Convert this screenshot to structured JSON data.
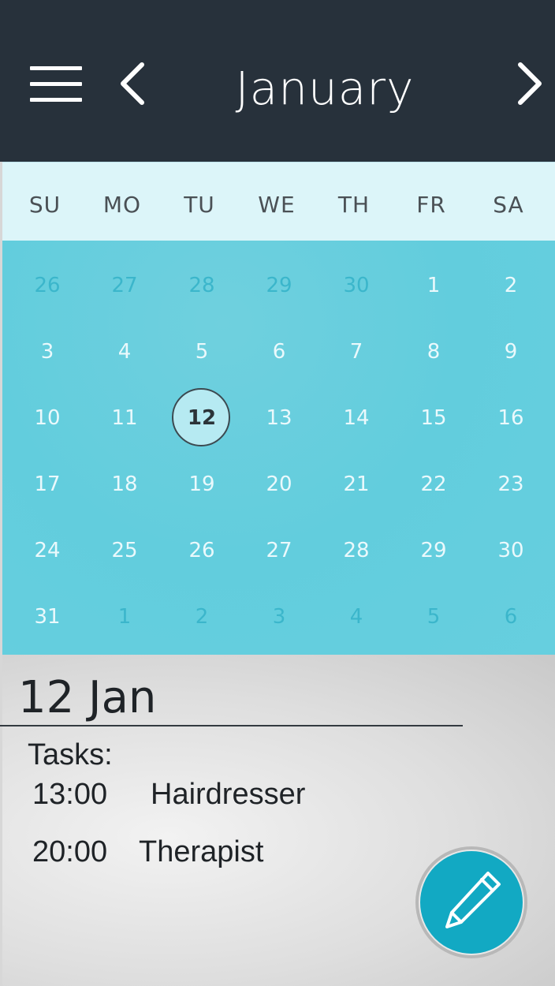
{
  "header": {
    "month": "January",
    "menu_icon": "hamburger-menu-icon",
    "prev_icon": "chevron-left-icon",
    "next_icon": "chevron-right-icon"
  },
  "weekdays": [
    "SU",
    "MO",
    "TU",
    "WE",
    "TH",
    "FR",
    "SA"
  ],
  "calendar": {
    "weeks": [
      [
        {
          "d": "26",
          "other": true
        },
        {
          "d": "27",
          "other": true
        },
        {
          "d": "28",
          "other": true
        },
        {
          "d": "29",
          "other": true
        },
        {
          "d": "30",
          "other": true
        },
        {
          "d": "1",
          "other": false
        },
        {
          "d": "2",
          "other": false
        }
      ],
      [
        {
          "d": "3",
          "other": false
        },
        {
          "d": "4",
          "other": false
        },
        {
          "d": "5",
          "other": false
        },
        {
          "d": "6",
          "other": false
        },
        {
          "d": "7",
          "other": false
        },
        {
          "d": "8",
          "other": false
        },
        {
          "d": "9",
          "other": false
        }
      ],
      [
        {
          "d": "10",
          "other": false
        },
        {
          "d": "11",
          "other": false
        },
        {
          "d": "12",
          "other": false,
          "selected": true
        },
        {
          "d": "13",
          "other": false
        },
        {
          "d": "14",
          "other": false
        },
        {
          "d": "15",
          "other": false
        },
        {
          "d": "16",
          "other": false
        }
      ],
      [
        {
          "d": "17",
          "other": false
        },
        {
          "d": "18",
          "other": false
        },
        {
          "d": "19",
          "other": false
        },
        {
          "d": "20",
          "other": false
        },
        {
          "d": "21",
          "other": false
        },
        {
          "d": "22",
          "other": false
        },
        {
          "d": "23",
          "other": false
        }
      ],
      [
        {
          "d": "24",
          "other": false
        },
        {
          "d": "25",
          "other": false
        },
        {
          "d": "26",
          "other": false
        },
        {
          "d": "27",
          "other": false
        },
        {
          "d": "28",
          "other": false
        },
        {
          "d": "29",
          "other": false
        },
        {
          "d": "30",
          "other": false
        }
      ],
      [
        {
          "d": "31",
          "other": false
        },
        {
          "d": "1",
          "other": true
        },
        {
          "d": "2",
          "other": true
        },
        {
          "d": "3",
          "other": true
        },
        {
          "d": "4",
          "other": true
        },
        {
          "d": "5",
          "other": true
        },
        {
          "d": "6",
          "other": true
        }
      ]
    ]
  },
  "detail": {
    "date": "12 Jan",
    "tasks_label": "Tasks:",
    "tasks": [
      {
        "time": "13:00",
        "name": "Hairdresser"
      },
      {
        "time": "20:00",
        "name": "Therapist"
      }
    ],
    "edit_icon": "pencil-icon"
  },
  "colors": {
    "topbar": "#27313b",
    "weekday_bg": "#dcf5f9",
    "grid_bg": "#66cfdf",
    "fab": "#12a9c3"
  }
}
